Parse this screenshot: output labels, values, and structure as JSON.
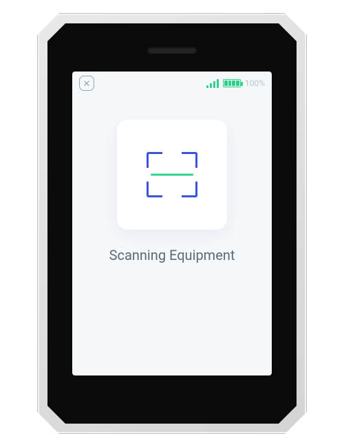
{
  "statusbar": {
    "close_glyph": "✕",
    "battery_percent": "100%"
  },
  "main": {
    "title": "Scanning Equipment"
  },
  "colors": {
    "accent_green": "#2fd08a",
    "accent_blue": "#3b55d9",
    "screen_bg": "#f5f8fb",
    "text_muted": "#5e6a72"
  }
}
